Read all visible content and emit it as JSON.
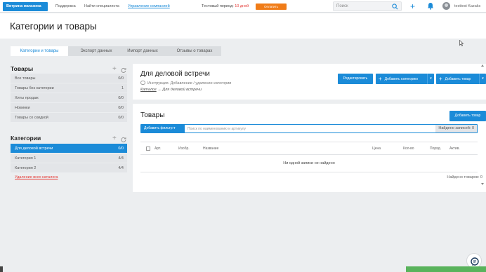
{
  "topbar": {
    "shop_button": "Витрина магазина",
    "links": [
      "Поддержка",
      "Найти специалиста",
      "Управление компанией"
    ],
    "trial_label": "Тестовый период:",
    "trial_days": "10 дней",
    "pay_button": "Оплатить",
    "search_placeholder": "Поиск",
    "user_name": "testtest Kazaks"
  },
  "page": {
    "title": "Категории и товары"
  },
  "tabs": [
    "Категории и товары",
    "Экспорт данных",
    "Импорт данных",
    "Отзывы о товарах"
  ],
  "products_panel": {
    "title": "Товары",
    "items": [
      {
        "label": "Все товары",
        "count": "0/0"
      },
      {
        "label": "Товары без категории",
        "count": "1"
      },
      {
        "label": "Хиты продаж",
        "count": "0/0"
      },
      {
        "label": "Новинки",
        "count": "0/0"
      },
      {
        "label": "Товары со скидкой",
        "count": "0/0"
      }
    ]
  },
  "categories_panel": {
    "title": "Категории",
    "items": [
      {
        "label": "Для деловой встречи",
        "count": "0/0"
      },
      {
        "label": "Категория 1",
        "count": "4/4"
      },
      {
        "label": "Категория 2",
        "count": "4/4"
      }
    ],
    "delete_link": "Удаление всех каталога"
  },
  "category": {
    "title": "Для деловой встречи",
    "instruction": "Инструкция. Добавление / удаление категории",
    "breadcrumb_root": "Каталог",
    "breadcrumb_sep": "→",
    "breadcrumb_current": "Для деловой встречи",
    "edit_button": "Редактировать",
    "add_category_button": "Добавить категорию",
    "add_product_button": "Добавить товар"
  },
  "goods": {
    "title": "Товары",
    "add_product_button": "Добавить товар",
    "filter_button": "Добавить фильтр",
    "search_placeholder": "Поиск по наименованию и артикулу",
    "found_label": "Найдено записей: 0",
    "columns": [
      "Арт.",
      "Изобр.",
      "Название",
      "Цена",
      "Кол-во",
      "Поряд.",
      "Актив."
    ],
    "empty_message": "Ни одной записи не найдено",
    "found_bottom": "Найдено товаров: 0"
  },
  "colors": {
    "accent": "#1b8bd8",
    "pay": "#f07c18",
    "danger": "#e53935"
  }
}
